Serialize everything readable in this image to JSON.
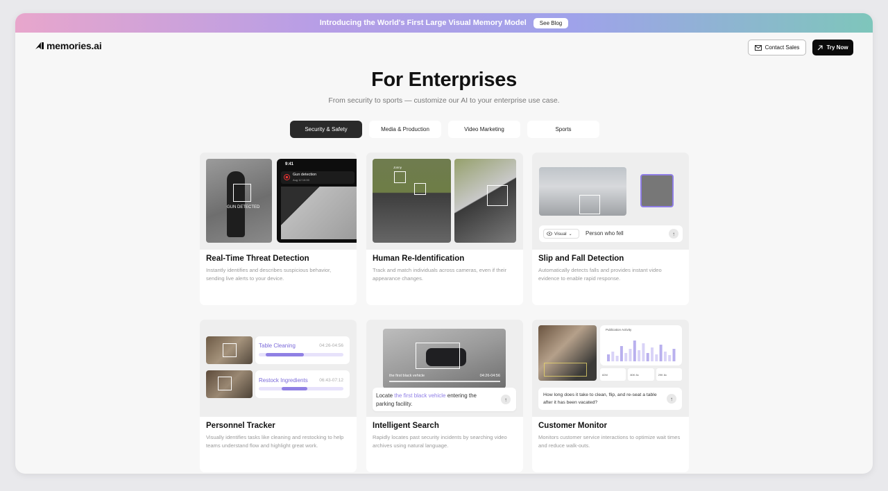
{
  "banner": {
    "text": "Introducing the World's First Large Visual Memory Model",
    "button": "See Blog"
  },
  "nav": {
    "logo": "memories.ai",
    "contact": "Contact Sales",
    "try": "Try Now"
  },
  "hero": {
    "title": "For Enterprises",
    "subtitle": "From security to sports — customize our AI to your enterprise use case."
  },
  "tabs": [
    {
      "label": "Security & Safety",
      "active": true
    },
    {
      "label": "Media & Production",
      "active": false
    },
    {
      "label": "Video Marketing",
      "active": false
    },
    {
      "label": "Sports",
      "active": false
    }
  ],
  "cards": [
    {
      "title": "Real-Time Threat Detection",
      "desc": "Instantly identifies and describes suspicious behavior, sending live alerts to your device.",
      "media": {
        "gun_label": "GUN DETECTED",
        "phone_time": "9:41",
        "alert_title": "Gun detection",
        "alert_date": "Aug 12 10:00"
      }
    },
    {
      "title": "Human Re-Identification",
      "desc": "Track and match individuals across cameras, even if their appearance changes.",
      "media": {
        "name_tag": "Jonny"
      }
    },
    {
      "title": "Slip and Fall Detection",
      "desc": "Automatically detects falls and provides instant video evidence to enable rapid response.",
      "media": {
        "mode": "Visual",
        "query": "Person who fell"
      }
    },
    {
      "title": "Personnel Tracker",
      "desc": "Visually identifies tasks like cleaning and restocking to help teams understand flow and highlight great work.",
      "media": {
        "tasks": [
          {
            "label": "Table Cleaning",
            "time": "04:26-04:56",
            "progress": 0.45
          },
          {
            "label": "Restock Ingredients",
            "time": "06:43-07:12",
            "progress": 0.3
          }
        ]
      }
    },
    {
      "title": "Intelligent Search",
      "desc": "Rapidly locates past security incidents by searching video archives using natural language.",
      "media": {
        "clip_label": "the first black vehicle",
        "clip_time": "04:26-04:56",
        "q_prefix": "Locate ",
        "q_highlight": "the first black vehicle",
        "q_suffix": " entering the parking facility."
      }
    },
    {
      "title": "Customer Monitor",
      "desc": "Monitors customer service interactions to optimize wait times and reduce walk-outs.",
      "media": {
        "panel_title": "Publication Activity",
        "question": "How long does it take to clean, flip, and re-seat a table after it has been vacated?",
        "stats": [
          "82M",
          "80K 8c",
          "29K 8c"
        ]
      }
    }
  ],
  "colors": {
    "accent": "#8f7ee6",
    "dark_button": "#0b0b0b",
    "active_tab": "#2a2a2a"
  }
}
